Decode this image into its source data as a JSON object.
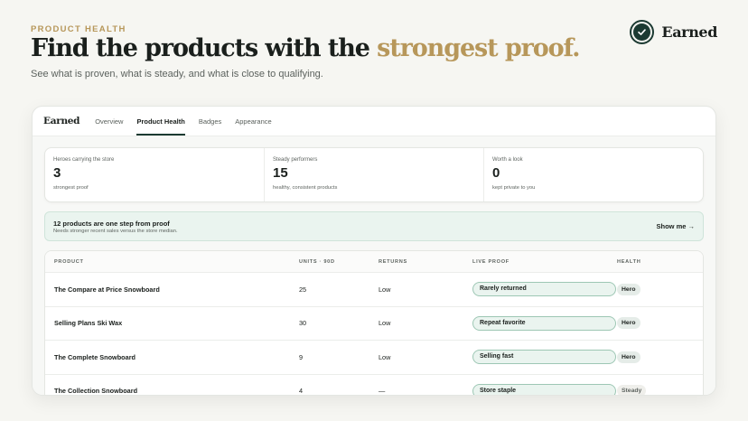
{
  "header": {
    "eyebrow": "PRODUCT HEALTH",
    "headline_main": "Find the products with the",
    "headline_accent": "strongest proof.",
    "subhead": "See what is proven, what is steady, and what is close to qualifying."
  },
  "brand": {
    "name": "Earned",
    "icon": "check-circle-icon"
  },
  "nav": {
    "logo": "Earned",
    "tabs": [
      {
        "label": "Overview",
        "active": false
      },
      {
        "label": "Product Health",
        "active": true
      },
      {
        "label": "Badges",
        "active": false
      },
      {
        "label": "Appearance",
        "active": false
      }
    ]
  },
  "stats": [
    {
      "label": "Heroes carrying the store",
      "value": "3",
      "note": "strongest proof"
    },
    {
      "label": "Steady performers",
      "value": "15",
      "note": "healthy, consistent products"
    },
    {
      "label": "Worth a look",
      "value": "0",
      "note": "kept private to you"
    }
  ],
  "banner": {
    "title": "12 products are one step from proof",
    "subtitle": "Needs stronger recent sales versus the store median.",
    "cta": "Show me →"
  },
  "table": {
    "columns": [
      "PRODUCT",
      "UNITS · 90D",
      "RETURNS",
      "LIVE PROOF",
      "HEALTH"
    ],
    "rows": [
      {
        "product": "The Compare at Price Snowboard",
        "units": "25",
        "returns": "Low",
        "proof": "Rarely returned",
        "health": "Hero"
      },
      {
        "product": "Selling Plans Ski Wax",
        "units": "30",
        "returns": "Low",
        "proof": "Repeat favorite",
        "health": "Hero"
      },
      {
        "product": "The Complete Snowboard",
        "units": "9",
        "returns": "Low",
        "proof": "Selling fast",
        "health": "Hero"
      },
      {
        "product": "The Collection Snowboard",
        "units": "4",
        "returns": "—",
        "proof": "Store staple",
        "health": "Steady"
      }
    ]
  },
  "colors": {
    "accent": "#b7975a",
    "brand_dark": "#1c3a32",
    "proof_bg": "#eaf4ef"
  }
}
